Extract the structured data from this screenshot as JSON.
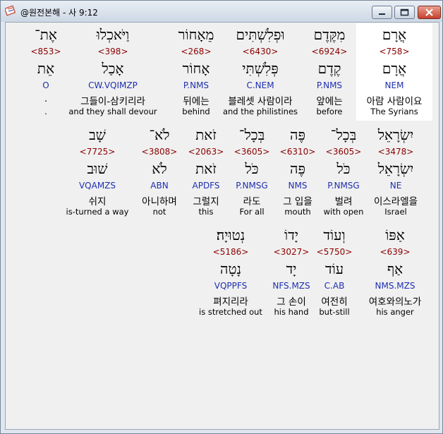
{
  "window": {
    "title": "@원전본해 - 사 9:12"
  },
  "rows": [
    [
      {
        "hebrew": "אֲרָם",
        "strong": "<758>",
        "lexeme": "אֲרָם",
        "morph": "NEM",
        "korean": "아람 사람이요",
        "english": "The Syrians",
        "highlight": true
      },
      {
        "hebrew": "מִקֶּדֶם",
        "strong": "<6924>",
        "lexeme": "קֶדֶם",
        "morph": "P.NMS",
        "korean": "앞에는",
        "english": "before"
      },
      {
        "hebrew": "וּפְלִשְׁתִּים",
        "strong": "<6430>",
        "lexeme": "פְּלִשְׁתִּי",
        "morph": "C.NEM",
        "korean": "블레셋 사람이라",
        "english": "and the philistines"
      },
      {
        "hebrew": "מֵאָחוֹר",
        "strong": "<268>",
        "lexeme": "אָחוֹר",
        "morph": "P.NMS",
        "korean": "뒤에는",
        "english": "behind"
      },
      {
        "hebrew": "וַיֹּאכְלוּ",
        "strong": "<398>",
        "lexeme": "אָכַל",
        "morph": "CW.VQIMZP",
        "korean": "그들이-삼키리라",
        "english": "and they shall devour"
      },
      {
        "hebrew": "אֶת־",
        "strong": "<853>",
        "lexeme": "אֵת",
        "morph": "O",
        "korean": ".",
        "english": "."
      }
    ],
    [
      {
        "hebrew": "יִשְׂרָאֵל",
        "strong": "<3478>",
        "lexeme": "יִשְׂרָאֵל",
        "morph": "NE",
        "korean": "이스라엘을",
        "english": "Israel"
      },
      {
        "hebrew": "בְּכָל־",
        "strong": "<3605>",
        "lexeme": "כֹּל",
        "morph": "P.NMSG",
        "korean": "벌려",
        "english": "with open"
      },
      {
        "hebrew": "פֶּה",
        "strong": "<6310>",
        "lexeme": "פֶּה",
        "morph": "NMS",
        "korean": "그 입을",
        "english": "mouth"
      },
      {
        "hebrew": "בְּכָל־",
        "strong": "<3605>",
        "lexeme": "כֹּל",
        "morph": "P.NMSG",
        "korean": "라도",
        "english": "For all"
      },
      {
        "hebrew": "זֹאת",
        "strong": "<2063>",
        "lexeme": "זֹאת",
        "morph": "APDFS",
        "korean": "그럴지",
        "english": "this"
      },
      {
        "hebrew": "לֹא־",
        "strong": "<3808>",
        "lexeme": "לֹא",
        "morph": "ABN",
        "korean": "아니하며",
        "english": "not"
      },
      {
        "hebrew": "שָׁב",
        "strong": "<7725>",
        "lexeme": "שׁוּב",
        "morph": "VQAMZS",
        "korean": "쉬지",
        "english": "is-turned a way"
      }
    ],
    [
      {
        "hebrew": "אַפּוֹ",
        "strong": "<639>",
        "lexeme": "אַף",
        "morph": "NMS.MZS",
        "korean": "여호와의노가",
        "english": "his anger"
      },
      {
        "hebrew": "וְעוֹד",
        "strong": "<5750>",
        "lexeme": "עוֹד",
        "morph": "C.AB",
        "korean": "여전히",
        "english": "but-still"
      },
      {
        "hebrew": "יָדוֹ",
        "strong": "<3027>",
        "lexeme": "יָד",
        "morph": "NFS.MZS",
        "korean": "그 손이",
        "english": "his hand"
      },
      {
        "hebrew": "נְטוּיָה׃",
        "strong": "<5186>",
        "lexeme": "נָטָה",
        "morph": "VQPPFS",
        "korean": "펴지리라",
        "english": "is stretched out"
      }
    ]
  ]
}
